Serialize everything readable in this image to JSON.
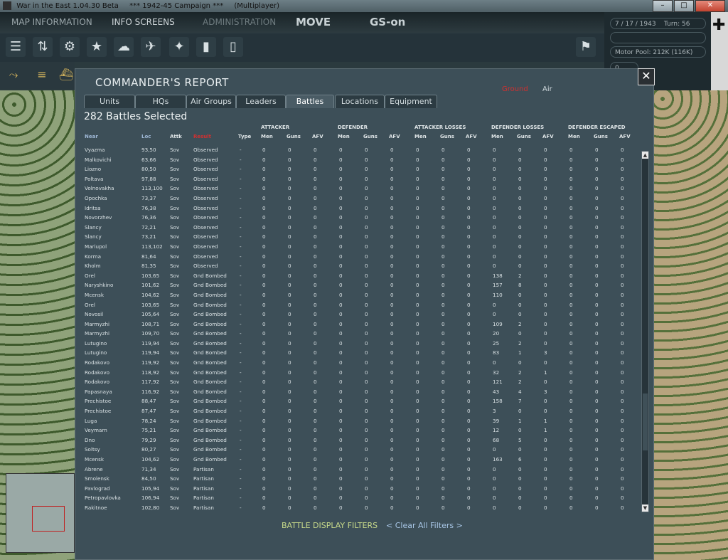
{
  "window": {
    "title": "War in the East 1.04.30 Beta",
    "campaign": "***   1942-45 Campaign   ***",
    "mode": "(Multiplayer)",
    "minimize": "–",
    "maximize": "□",
    "close": "✕"
  },
  "menu": {
    "map_information": "MAP INFORMATION",
    "info_screens": "INFO SCREENS",
    "administration": "ADMINISTRATION",
    "move": "MOVE",
    "gs": "GS-on"
  },
  "status": {
    "date": "7 / 17 / 1943",
    "turn": "Turn: 56",
    "motor_pool": "Motor Pool:  212K (116K)",
    "zero": "0"
  },
  "dialog": {
    "title": "COMMANDER'S REPORT",
    "filter_ground": "Ground",
    "filter_air": "Air",
    "tabs": [
      "Units",
      "HQs",
      "Air Groups",
      "Leaders",
      "Battles",
      "Locations",
      "Equipment"
    ],
    "active_tab": "Battles",
    "count": "282 Battles Selected",
    "groups": {
      "attacker": "ATTACKER",
      "defender": "DEFENDER",
      "attacker_losses": "ATTACKER LOSSES",
      "defender_losses": "DEFENDER LOSSES",
      "defender_escaped": "DEFENDER ESCAPED"
    },
    "columns": {
      "near": "Near",
      "loc": "Loc",
      "attk": "Attk",
      "result": "Result",
      "type": "Type",
      "men": "Men",
      "guns": "Guns",
      "afv": "AFV"
    },
    "footer_filters": "BATTLE DISPLAY FILTERS",
    "footer_clear": "< Clear All Filters >"
  },
  "battles": [
    [
      "Vyazma",
      "93,50",
      "Sov",
      "Observed",
      "-",
      "0",
      "0",
      "0",
      "0",
      "0",
      "0",
      "0",
      "0",
      "0",
      "0",
      "0",
      "0",
      "0",
      "0",
      "0"
    ],
    [
      "Malkovichi",
      "63,66",
      "Sov",
      "Observed",
      "-",
      "0",
      "0",
      "0",
      "0",
      "0",
      "0",
      "0",
      "0",
      "0",
      "0",
      "0",
      "0",
      "0",
      "0",
      "0"
    ],
    [
      "Liozno",
      "80,50",
      "Sov",
      "Observed",
      "-",
      "0",
      "0",
      "0",
      "0",
      "0",
      "0",
      "0",
      "0",
      "0",
      "0",
      "0",
      "0",
      "0",
      "0",
      "0"
    ],
    [
      "Poltava",
      "97,88",
      "Sov",
      "Observed",
      "-",
      "0",
      "0",
      "0",
      "0",
      "0",
      "0",
      "0",
      "0",
      "0",
      "0",
      "0",
      "0",
      "0",
      "0",
      "0"
    ],
    [
      "Volnovakha",
      "113,100",
      "Sov",
      "Observed",
      "-",
      "0",
      "0",
      "0",
      "0",
      "0",
      "0",
      "0",
      "0",
      "0",
      "0",
      "0",
      "0",
      "0",
      "0",
      "0"
    ],
    [
      "Opochka",
      "73,37",
      "Sov",
      "Observed",
      "-",
      "0",
      "0",
      "0",
      "0",
      "0",
      "0",
      "0",
      "0",
      "0",
      "0",
      "0",
      "0",
      "0",
      "0",
      "0"
    ],
    [
      "Idritsa",
      "76,38",
      "Sov",
      "Observed",
      "-",
      "0",
      "0",
      "0",
      "0",
      "0",
      "0",
      "0",
      "0",
      "0",
      "0",
      "0",
      "0",
      "0",
      "0",
      "0"
    ],
    [
      "Novorzhev",
      "76,36",
      "Sov",
      "Observed",
      "-",
      "0",
      "0",
      "0",
      "0",
      "0",
      "0",
      "0",
      "0",
      "0",
      "0",
      "0",
      "0",
      "0",
      "0",
      "0"
    ],
    [
      "Slancy",
      "72,21",
      "Sov",
      "Observed",
      "-",
      "0",
      "0",
      "0",
      "0",
      "0",
      "0",
      "0",
      "0",
      "0",
      "0",
      "0",
      "0",
      "0",
      "0",
      "0"
    ],
    [
      "Slancy",
      "73,21",
      "Sov",
      "Observed",
      "-",
      "0",
      "0",
      "0",
      "0",
      "0",
      "0",
      "0",
      "0",
      "0",
      "0",
      "0",
      "0",
      "0",
      "0",
      "0"
    ],
    [
      "Mariupol",
      "113,102",
      "Sov",
      "Observed",
      "-",
      "0",
      "0",
      "0",
      "0",
      "0",
      "0",
      "0",
      "0",
      "0",
      "0",
      "0",
      "0",
      "0",
      "0",
      "0"
    ],
    [
      "Korma",
      "81,64",
      "Sov",
      "Observed",
      "-",
      "0",
      "0",
      "0",
      "0",
      "0",
      "0",
      "0",
      "0",
      "0",
      "0",
      "0",
      "0",
      "0",
      "0",
      "0"
    ],
    [
      "Kholm",
      "81,35",
      "Sov",
      "Observed",
      "-",
      "0",
      "0",
      "0",
      "0",
      "0",
      "0",
      "0",
      "0",
      "0",
      "0",
      "0",
      "0",
      "0",
      "0",
      "0"
    ],
    [
      "Orel",
      "103,65",
      "Sov",
      "Gnd Bombed",
      "-",
      "0",
      "0",
      "0",
      "0",
      "0",
      "0",
      "0",
      "0",
      "0",
      "138",
      "2",
      "0",
      "0",
      "0",
      "0"
    ],
    [
      "Naryshkino",
      "101,62",
      "Sov",
      "Gnd Bombed",
      "-",
      "0",
      "0",
      "0",
      "0",
      "0",
      "0",
      "0",
      "0",
      "0",
      "157",
      "8",
      "0",
      "0",
      "0",
      "0"
    ],
    [
      "Mcensk",
      "104,62",
      "Sov",
      "Gnd Bombed",
      "-",
      "0",
      "0",
      "0",
      "0",
      "0",
      "0",
      "0",
      "0",
      "0",
      "110",
      "0",
      "0",
      "0",
      "0",
      "0"
    ],
    [
      "Orel",
      "103,65",
      "Sov",
      "Gnd Bombed",
      "-",
      "0",
      "0",
      "0",
      "0",
      "0",
      "0",
      "0",
      "0",
      "0",
      "0",
      "0",
      "0",
      "0",
      "0",
      "0"
    ],
    [
      "Novosil",
      "105,64",
      "Sov",
      "Gnd Bombed",
      "-",
      "0",
      "0",
      "0",
      "0",
      "0",
      "0",
      "0",
      "0",
      "0",
      "0",
      "0",
      "0",
      "0",
      "0",
      "0"
    ],
    [
      "Marmyzhi",
      "108,71",
      "Sov",
      "Gnd Bombed",
      "-",
      "0",
      "0",
      "0",
      "0",
      "0",
      "0",
      "0",
      "0",
      "0",
      "109",
      "2",
      "0",
      "0",
      "0",
      "0"
    ],
    [
      "Marmyzhi",
      "109,70",
      "Sov",
      "Gnd Bombed",
      "-",
      "0",
      "0",
      "0",
      "0",
      "0",
      "0",
      "0",
      "0",
      "0",
      "20",
      "0",
      "0",
      "0",
      "0",
      "0"
    ],
    [
      "Lutugino",
      "119,94",
      "Sov",
      "Gnd Bombed",
      "-",
      "0",
      "0",
      "0",
      "0",
      "0",
      "0",
      "0",
      "0",
      "0",
      "25",
      "2",
      "0",
      "0",
      "0",
      "0"
    ],
    [
      "Lutugino",
      "119,94",
      "Sov",
      "Gnd Bombed",
      "-",
      "0",
      "0",
      "0",
      "0",
      "0",
      "0",
      "0",
      "0",
      "0",
      "83",
      "1",
      "3",
      "0",
      "0",
      "0"
    ],
    [
      "Rodakovo",
      "119,92",
      "Sov",
      "Gnd Bombed",
      "-",
      "0",
      "0",
      "0",
      "0",
      "0",
      "0",
      "0",
      "0",
      "0",
      "0",
      "0",
      "0",
      "0",
      "0",
      "0"
    ],
    [
      "Rodakovo",
      "118,92",
      "Sov",
      "Gnd Bombed",
      "-",
      "0",
      "0",
      "0",
      "0",
      "0",
      "0",
      "0",
      "0",
      "0",
      "32",
      "2",
      "1",
      "0",
      "0",
      "0"
    ],
    [
      "Rodakovo",
      "117,92",
      "Sov",
      "Gnd Bombed",
      "-",
      "0",
      "0",
      "0",
      "0",
      "0",
      "0",
      "0",
      "0",
      "0",
      "121",
      "2",
      "0",
      "0",
      "0",
      "0"
    ],
    [
      "Papasnaya",
      "116,92",
      "Sov",
      "Gnd Bombed",
      "-",
      "0",
      "0",
      "0",
      "0",
      "0",
      "0",
      "0",
      "0",
      "0",
      "43",
      "4",
      "3",
      "0",
      "0",
      "0"
    ],
    [
      "Prechistoe",
      "88,47",
      "Sov",
      "Gnd Bombed",
      "-",
      "0",
      "0",
      "0",
      "0",
      "0",
      "0",
      "0",
      "0",
      "0",
      "158",
      "7",
      "0",
      "0",
      "0",
      "0"
    ],
    [
      "Prechistoe",
      "87,47",
      "Sov",
      "Gnd Bombed",
      "-",
      "0",
      "0",
      "0",
      "0",
      "0",
      "0",
      "0",
      "0",
      "0",
      "3",
      "0",
      "0",
      "0",
      "0",
      "0"
    ],
    [
      "Luga",
      "78,24",
      "Sov",
      "Gnd Bombed",
      "-",
      "0",
      "0",
      "0",
      "0",
      "0",
      "0",
      "0",
      "0",
      "0",
      "39",
      "1",
      "1",
      "0",
      "0",
      "0"
    ],
    [
      "Veymarn",
      "75,21",
      "Sov",
      "Gnd Bombed",
      "-",
      "0",
      "0",
      "0",
      "0",
      "0",
      "0",
      "0",
      "0",
      "0",
      "12",
      "0",
      "1",
      "0",
      "0",
      "0"
    ],
    [
      "Dno",
      "79,29",
      "Sov",
      "Gnd Bombed",
      "-",
      "0",
      "0",
      "0",
      "0",
      "0",
      "0",
      "0",
      "0",
      "0",
      "68",
      "5",
      "0",
      "0",
      "0",
      "0"
    ],
    [
      "Soltsy",
      "80,27",
      "Sov",
      "Gnd Bombed",
      "-",
      "0",
      "0",
      "0",
      "0",
      "0",
      "0",
      "0",
      "0",
      "0",
      "0",
      "0",
      "0",
      "0",
      "0",
      "0"
    ],
    [
      "Mcensk",
      "104,62",
      "Sov",
      "Gnd Bombed",
      "-",
      "0",
      "0",
      "0",
      "0",
      "0",
      "0",
      "0",
      "0",
      "0",
      "163",
      "6",
      "0",
      "0",
      "0",
      "0"
    ],
    [
      "Abrene",
      "71,34",
      "Sov",
      "Partisan",
      "-",
      "0",
      "0",
      "0",
      "0",
      "0",
      "0",
      "0",
      "0",
      "0",
      "0",
      "0",
      "0",
      "0",
      "0",
      "0"
    ],
    [
      "Smolensk",
      "84,50",
      "Sov",
      "Partisan",
      "-",
      "0",
      "0",
      "0",
      "0",
      "0",
      "0",
      "0",
      "0",
      "0",
      "0",
      "0",
      "0",
      "0",
      "0",
      "0"
    ],
    [
      "Pavlograd",
      "105,94",
      "Sov",
      "Partisan",
      "-",
      "0",
      "0",
      "0",
      "0",
      "0",
      "0",
      "0",
      "0",
      "0",
      "0",
      "0",
      "0",
      "0",
      "0",
      "0"
    ],
    [
      "Petropavlovka",
      "106,94",
      "Sov",
      "Partisan",
      "-",
      "0",
      "0",
      "0",
      "0",
      "0",
      "0",
      "0",
      "0",
      "0",
      "0",
      "0",
      "0",
      "0",
      "0",
      "0"
    ],
    [
      "Rakitnoe",
      "102,80",
      "Sov",
      "Partisan",
      "-",
      "0",
      "0",
      "0",
      "0",
      "0",
      "0",
      "0",
      "0",
      "0",
      "0",
      "0",
      "0",
      "0",
      "0",
      "0"
    ]
  ],
  "colors": {
    "accent_red": "#d03030",
    "filter_green": "#c7d98a",
    "link_blue": "#a8c6e6"
  }
}
